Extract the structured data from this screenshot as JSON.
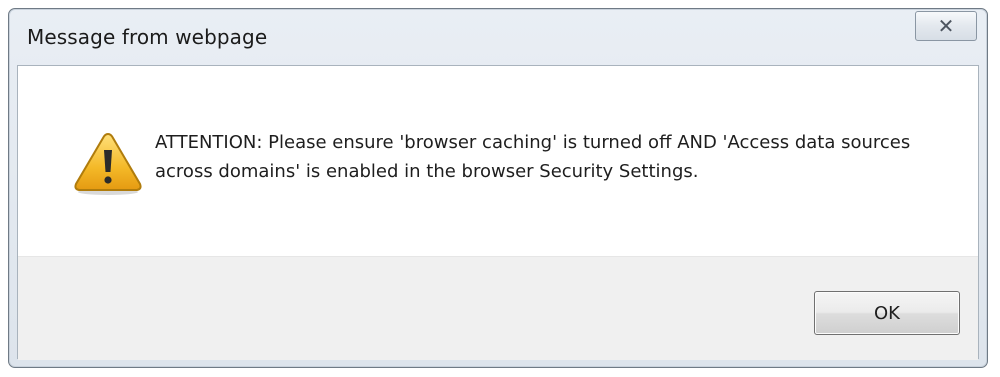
{
  "dialog": {
    "title": "Message from webpage",
    "close_glyph": "✕",
    "close_icon": "close-icon",
    "warning_icon": "warning-icon",
    "message": "ATTENTION: Please ensure 'browser caching' is turned off AND 'Access data sources across domains' is enabled in the browser Security Settings.",
    "ok_label": "OK"
  },
  "colors": {
    "warning_fill": "#f6c343",
    "warning_stroke": "#b8860b",
    "frame_border": "#6f7a85"
  }
}
